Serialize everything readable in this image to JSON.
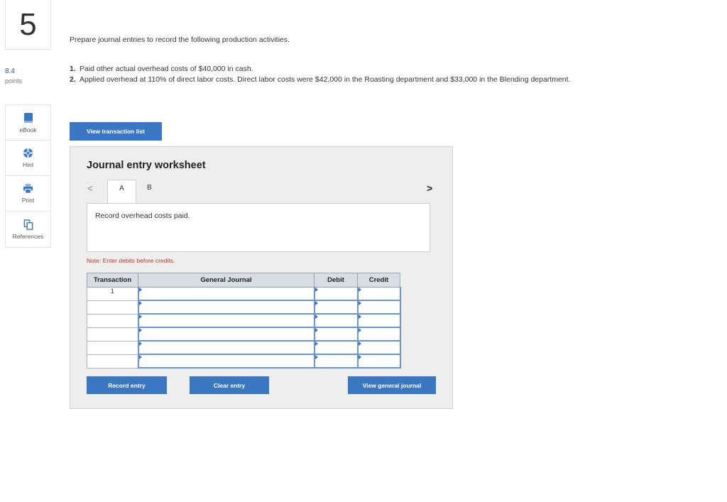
{
  "question": {
    "number": "5",
    "points_value": "8.4",
    "points_label": "points"
  },
  "tools": [
    {
      "label": "eBook",
      "icon": "book-icon"
    },
    {
      "label": "Hint",
      "icon": "lifebuoy-icon"
    },
    {
      "label": "Print",
      "icon": "printer-icon"
    },
    {
      "label": "References",
      "icon": "copy-icon"
    }
  ],
  "prompt": "Prepare journal entries to record the following production activities.",
  "items": [
    {
      "num": "1.",
      "text": "Paid other actual overhead costs of $40,000 in cash."
    },
    {
      "num": "2.",
      "text": "Applied overhead at 110% of direct labor costs. Direct labor costs were $42,000 in the Roasting department and $33,000 in the Blending department."
    }
  ],
  "view_list_label": "View transaction list",
  "worksheet": {
    "title": "Journal entry worksheet",
    "nav_prev": "<",
    "nav_next": ">",
    "tabs": [
      "A",
      "B"
    ],
    "active_tab": "A",
    "description": "Record overhead costs paid.",
    "note": "Note: Enter debits before credits.",
    "columns": [
      "Transaction",
      "General Journal",
      "Debit",
      "Credit"
    ],
    "rows": [
      {
        "transaction": "1"
      },
      {
        "transaction": ""
      },
      {
        "transaction": ""
      },
      {
        "transaction": ""
      },
      {
        "transaction": ""
      },
      {
        "transaction": ""
      }
    ],
    "record_label": "Record entry",
    "clear_label": "Clear entry",
    "general_label": "View general journal"
  },
  "colors": {
    "accent": "#3b76c2",
    "note": "#b5372f",
    "panel": "#eeeeee"
  }
}
